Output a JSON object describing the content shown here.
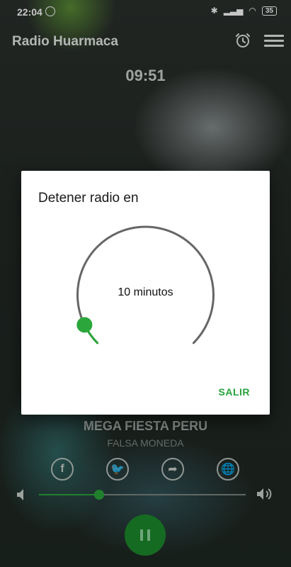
{
  "status_bar": {
    "time": "22:04",
    "battery": "35"
  },
  "app": {
    "title": "Radio Huarmaca"
  },
  "player": {
    "timer": "09:51",
    "song_title": "MEGA FIESTA PERU",
    "artist": "FALSA MONEDA",
    "volume_fraction": 0.29
  },
  "social": [
    {
      "name": "facebook-icon",
      "glyph": "f"
    },
    {
      "name": "twitter-icon",
      "glyph": "🐦"
    },
    {
      "name": "share-icon",
      "glyph": "➦"
    },
    {
      "name": "globe-icon",
      "glyph": "🌐"
    }
  ],
  "dialog": {
    "title": "Detener radio en",
    "value_label": "10 minutos",
    "exit_label": "SALIR",
    "timer_fraction": 0.04
  },
  "colors": {
    "accent": "#2aa63a",
    "dial_track": "#666666"
  },
  "icons": [
    "alarm-icon",
    "menu-icon",
    "volume-low-icon",
    "volume-high-icon",
    "pause-icon"
  ]
}
